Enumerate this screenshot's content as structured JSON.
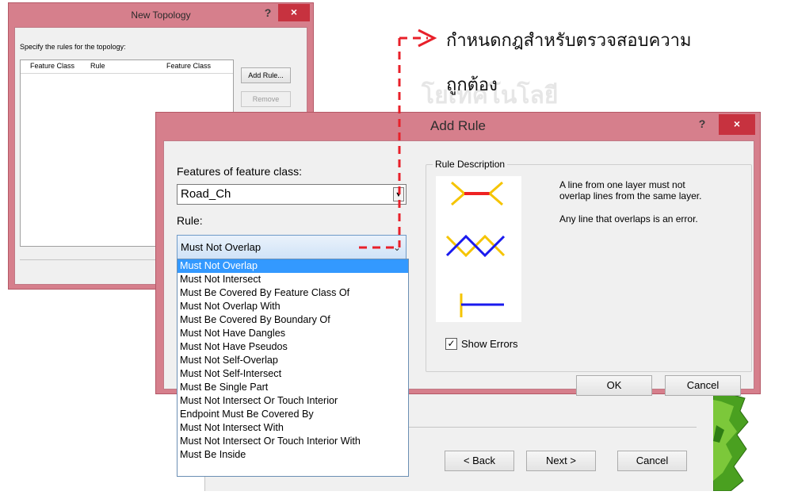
{
  "new_topology": {
    "title": "New Topology",
    "help": "?",
    "close": "×",
    "instruction": "Specify the rules for the topology:",
    "columns": [
      "Feature Class",
      "Rule",
      "Feature Class"
    ],
    "add_rule_label": "Add Rule...",
    "remove_label": "Remove"
  },
  "add_rule": {
    "title": "Add Rule",
    "help": "?",
    "close": "×",
    "features_label": "Features of feature class:",
    "feature_class_value": "Road_Ch",
    "rule_label": "Rule:",
    "rule_value": "Must Not Overlap",
    "rule_description_legend": "Rule Description",
    "description_line1": "A line from one layer must not",
    "description_line2": "overlap lines from the same layer.",
    "description_line3": "Any line that overlaps is an error.",
    "show_errors_label": "Show Errors",
    "show_errors_checked": true,
    "ok_label": "OK",
    "cancel_label": "Cancel"
  },
  "rule_options": [
    "Must Not Overlap",
    "Must Not Intersect",
    "Must Be Covered By Feature Class Of",
    "Must Not Overlap With",
    "Must Be Covered By Boundary Of",
    "Must Not Have Dangles",
    "Must Not Have Pseudos",
    "Must Not Self-Overlap",
    "Must Not Self-Intersect",
    "Must Be Single Part",
    "Must Not Intersect Or Touch Interior",
    "Endpoint Must Be Covered By",
    "Must Not Intersect With",
    "Must Not Intersect Or Touch Interior With",
    "Must Be Inside"
  ],
  "wizard": {
    "back_label": "< Back",
    "next_label": "Next >",
    "cancel_label": "Cancel"
  },
  "annotation": {
    "line1": "กำหนดกฎสำหรับตรวจสอบความ",
    "line2": "ถูกต้อง",
    "arrow_color": "#e8202a"
  },
  "watermark_text": "โยเทคโนโลยี",
  "colors": {
    "titlebar": "#d67f8c",
    "close_button": "#c7323f",
    "selection": "#3399ff",
    "rule_red": "#ee2222",
    "rule_yellow": "#f5c400",
    "rule_blue": "#1a1aee"
  }
}
